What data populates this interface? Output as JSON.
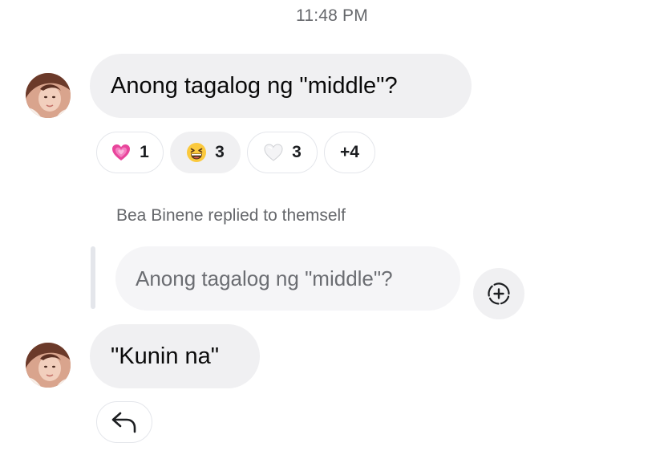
{
  "thread": {
    "timestamp": "11:48 PM",
    "messages": [
      {
        "sender": "Bea Binene",
        "text": "Anong tagalog ng \"middle\"?",
        "reactions": [
          {
            "emoji": "growing-heart",
            "count": "1",
            "selected": false
          },
          {
            "emoji": "grinning-squinting-face",
            "count": "3",
            "selected": true
          },
          {
            "emoji": "white-heart",
            "count": "3",
            "selected": false
          },
          {
            "label": "+4"
          }
        ]
      },
      {
        "sender": "Bea Binene",
        "reply_caption": "Bea Binene replied to themself",
        "quoted_text": "Anong tagalog ng \"middle\"?",
        "text": "\"Kunin na\""
      }
    ]
  },
  "icons": {
    "add_reaction": "add-reaction-icon",
    "reply": "reply-arrow-icon"
  },
  "colors": {
    "bubble_bg": "#f0f0f2",
    "muted_text": "#65676b",
    "reaction_border": "#e4e6eb"
  }
}
